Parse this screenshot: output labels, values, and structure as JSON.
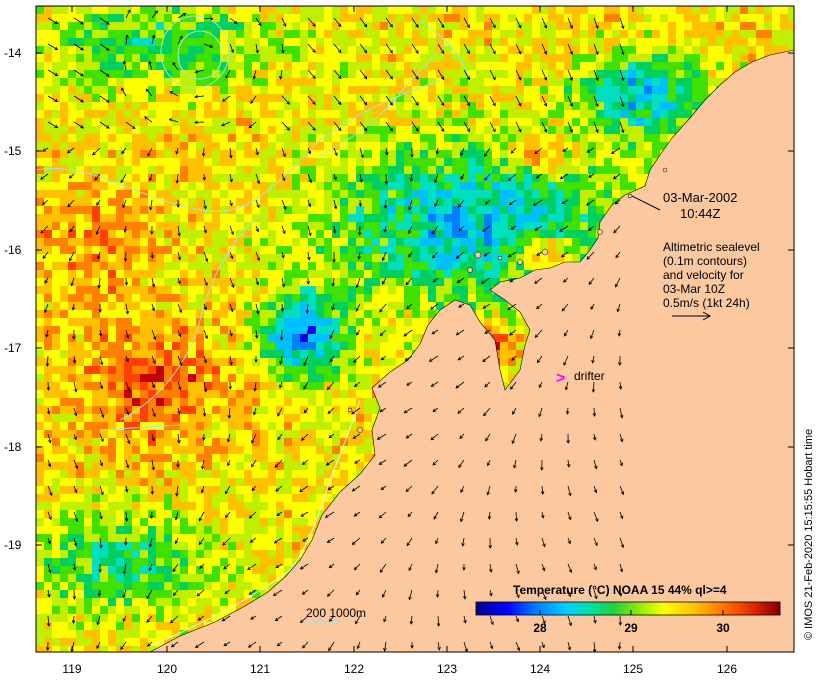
{
  "map": {
    "lat_ticks": [
      "-14",
      "-15",
      "-16",
      "-17",
      "-18",
      "-19"
    ],
    "lon_ticks": [
      "119",
      "120",
      "121",
      "122",
      "123",
      "124",
      "125",
      "126"
    ],
    "colors": {
      "land": "#fcc8a0",
      "contour": "#9fe8e0",
      "arrow": "#000000"
    }
  },
  "annotation": {
    "date": "03-Mar-2002",
    "time": "10:44Z",
    "legend_lines": [
      "Altimetric sealevel",
      "(0.1m contours)",
      "and velocity for",
      "03-Mar 10Z",
      "0.5m/s (1kt 24h)"
    ]
  },
  "drifter": {
    "marker": ">",
    "label": "drifter",
    "color": "#ff00ff"
  },
  "depth_legend": {
    "label": "200  1000m"
  },
  "colorbar": {
    "title": "Temperature (°C) NOAA 15 44% ql>=4",
    "ticks": [
      "28",
      "29",
      "30"
    ],
    "colors": [
      "#00008b",
      "#0000ff",
      "#0080ff",
      "#00c0ff",
      "#00e0c0",
      "#00d060",
      "#40e000",
      "#c0f000",
      "#ffff00",
      "#ffc000",
      "#ff8000",
      "#ff4000",
      "#c00000",
      "#800000"
    ]
  },
  "credit": "© IMOS 21-Feb-2020 15:15:55 Hobart time"
}
